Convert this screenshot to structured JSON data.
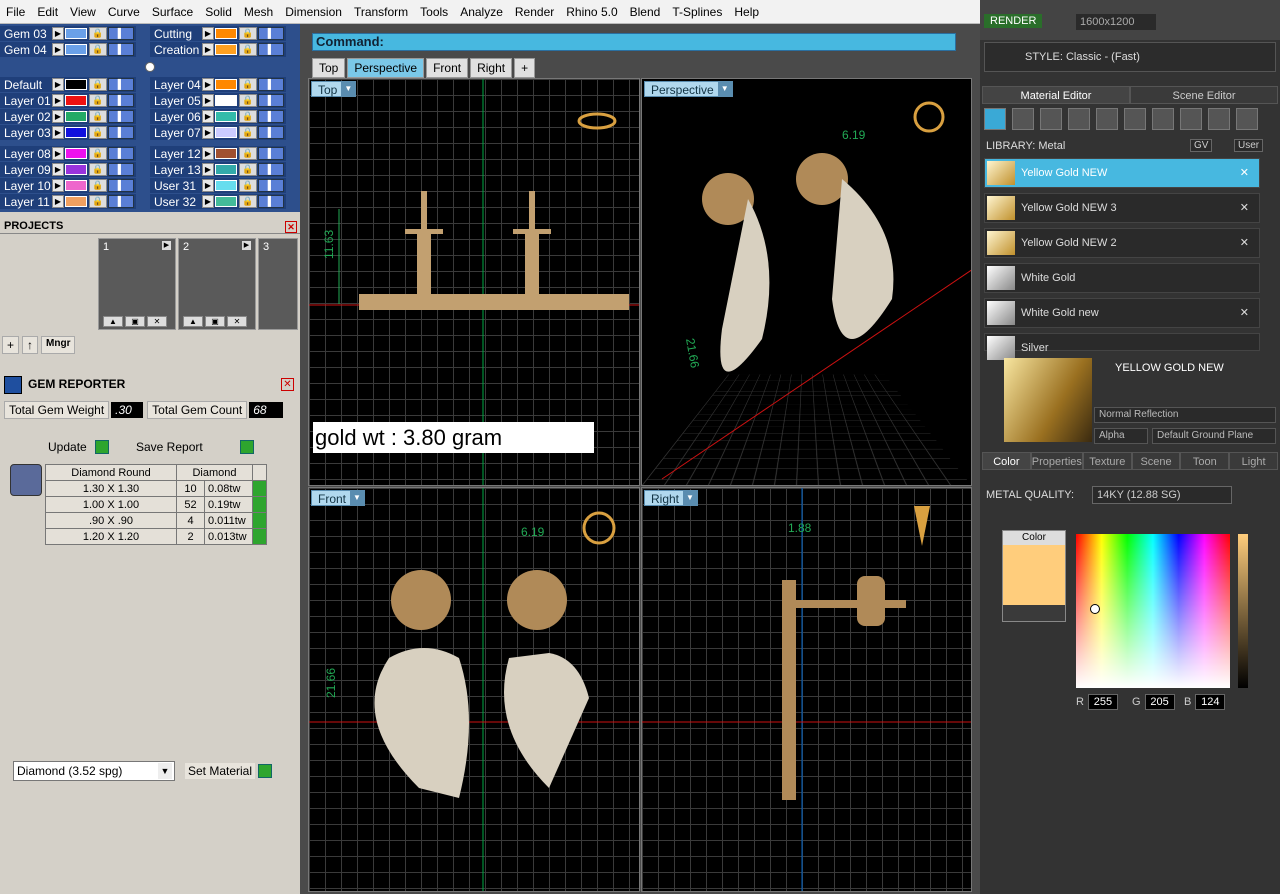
{
  "menu": [
    "File",
    "Edit",
    "View",
    "Curve",
    "Surface",
    "Solid",
    "Mesh",
    "Dimension",
    "Transform",
    "Tools",
    "Analyze",
    "Render",
    "Rhino 5.0",
    "Blend",
    "T-Splines",
    "Help"
  ],
  "layers_left": [
    {
      "name": "Gem 03",
      "color": "#6aa0e8"
    },
    {
      "name": "Gem 04",
      "color": "#6aa0e8"
    },
    {
      "name": "Default",
      "color": "#000000"
    },
    {
      "name": "Layer 01",
      "color": "#ee1111"
    },
    {
      "name": "Layer 02",
      "color": "#22aa66"
    },
    {
      "name": "Layer 03",
      "color": "#1111dd"
    },
    {
      "name": "Layer 08",
      "color": "#ee11ee"
    },
    {
      "name": "Layer 09",
      "color": "#9933dd"
    },
    {
      "name": "Layer 10",
      "color": "#ee66cc"
    },
    {
      "name": "Layer 11",
      "color": "#f0a060"
    }
  ],
  "layers_right": [
    {
      "name": "Cutting",
      "color": "#ff8800"
    },
    {
      "name": "Creation",
      "color": "#ffa020"
    },
    {
      "name": "Layer 04",
      "color": "#ff8800"
    },
    {
      "name": "Layer 05",
      "color": "#ffffff"
    },
    {
      "name": "Layer 06",
      "color": "#33bbaa"
    },
    {
      "name": "Layer 07",
      "color": "#ccccff"
    },
    {
      "name": "Layer 12",
      "color": "#a05030"
    },
    {
      "name": "Layer 13",
      "color": "#33aaaa"
    },
    {
      "name": "User 31",
      "color": "#66ddee"
    },
    {
      "name": "User 32",
      "color": "#44bb99"
    }
  ],
  "projects": {
    "title": "PROJECTS",
    "slots": [
      "1",
      "2",
      "3"
    ],
    "mngr": "Mngr"
  },
  "gem_reporter": {
    "title": "GEM REPORTER",
    "weight_label": "Total Gem Weight",
    "weight": ".30",
    "count_label": "Total Gem Count",
    "count": "68",
    "update": "Update",
    "save": "Save Report",
    "col1": "Diamond Round",
    "col2": "Diamond",
    "rows": [
      {
        "size": "1.30 X 1.30",
        "qty": "10",
        "tw": "0.08tw"
      },
      {
        "size": "1.00 X 1.00",
        "qty": "52",
        "tw": "0.19tw"
      },
      {
        "size": ".90 X .90",
        "qty": "4",
        "tw": "0.011tw"
      },
      {
        "size": "1.20 X 1.20",
        "qty": "2",
        "tw": "0.013tw"
      }
    ],
    "material": "Diamond    (3.52 spg)",
    "set_material": "Set Material"
  },
  "command": "Command:",
  "view_tabs": [
    "Top",
    "Perspective",
    "Front",
    "Right",
    "+"
  ],
  "viewports": [
    "Top",
    "Perspective",
    "Front",
    "Right"
  ],
  "dims": {
    "top": "11.63",
    "persp_a": "6.19",
    "persp_b": "21.66",
    "front_a": "6.19",
    "front_b": "21.66",
    "right": "1.88"
  },
  "gold_note": "gold wt : 3.80 gram",
  "render": {
    "btn": "RENDER",
    "res": "1600x1200"
  },
  "style": "STYLE:  Classic - (Fast)",
  "rtabs": [
    "Material Editor",
    "Scene Editor"
  ],
  "library": "LIBRARY: Metal",
  "lib_tags": [
    "GV",
    "User"
  ],
  "materials": [
    "Yellow Gold NEW",
    "Yellow Gold NEW 3",
    "Yellow Gold NEW 2",
    "White Gold",
    "White Gold new",
    "Silver"
  ],
  "preview_title": "YELLOW GOLD NEW",
  "reflection": "Normal Reflection",
  "alpha": "Alpha",
  "ground": "Default Ground Plane",
  "ptabs": [
    "Color",
    "Properties",
    "Texture",
    "Scene",
    "Toon",
    "Light"
  ],
  "metal_quality_label": "METAL QUALITY:",
  "metal_quality": "14KY         (12.88 SG)",
  "color_label": "Color",
  "rgb": {
    "r": "255",
    "g": "205",
    "b": "124"
  }
}
